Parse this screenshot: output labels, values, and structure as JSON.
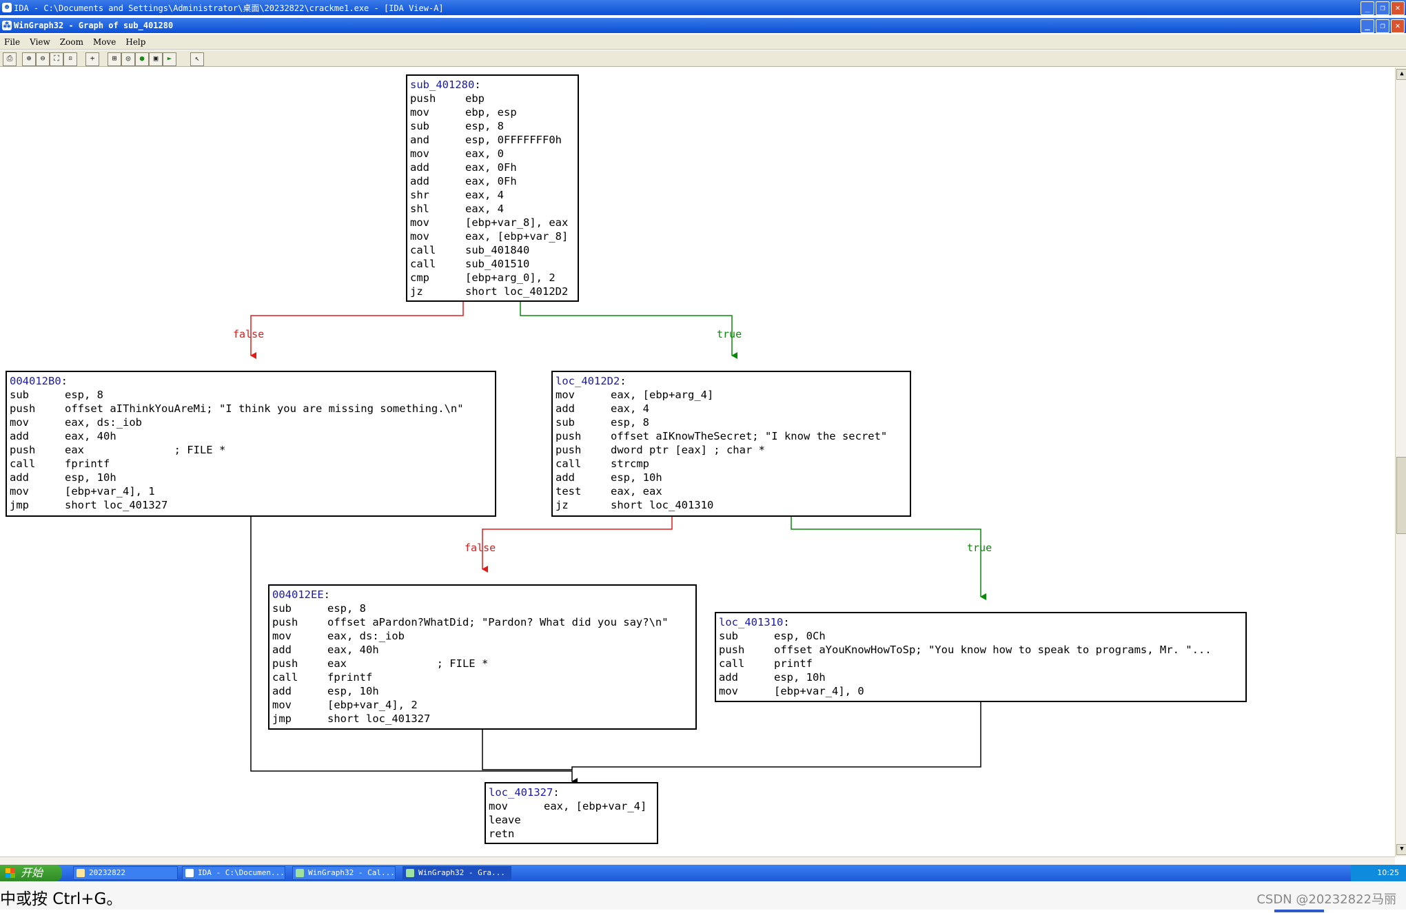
{
  "window": {
    "outer_title": "IDA - C:\\Documents and Settings\\Administrator\\桌面\\20232822\\crackme1.exe - [IDA View-A]",
    "inner_title": "WinGraph32 - Graph of sub_401280",
    "buttons": {
      "minimize": "_",
      "restore": "❐",
      "close": "✕"
    }
  },
  "menu": [
    "File",
    "View",
    "Zoom",
    "Move",
    "Help"
  ],
  "toolbar": {
    "icons": [
      "print-icon",
      "zoom-in-icon",
      "zoom-out-icon",
      "fit-icon",
      "zoom-100-icon",
      "center-icon",
      "layout-icon",
      "circle-icon",
      "green-circle-icon",
      "overview-icon",
      "green-arrow-icon",
      "cursor-icon"
    ]
  },
  "graph": {
    "nodes": {
      "sub_401280": {
        "label": "sub_401280",
        "rows": [
          [
            "push",
            "ebp"
          ],
          [
            "mov",
            "ebp, esp"
          ],
          [
            "sub",
            "esp, 8"
          ],
          [
            "and",
            "esp, 0FFFFFFF0h"
          ],
          [
            "mov",
            "eax, 0"
          ],
          [
            "add",
            "eax, 0Fh"
          ],
          [
            "add",
            "eax, 0Fh"
          ],
          [
            "shr",
            "eax, 4"
          ],
          [
            "shl",
            "eax, 4"
          ],
          [
            "mov",
            "[ebp+var_8], eax"
          ],
          [
            "mov",
            "eax, [ebp+var_8]"
          ],
          [
            "call",
            "sub_401840"
          ],
          [
            "call",
            "sub_401510"
          ],
          [
            "cmp",
            "[ebp+arg_0], 2"
          ],
          [
            "jz",
            "short loc_4012D2"
          ]
        ]
      },
      "n_4012B0": {
        "label": "004012B0",
        "rows": [
          [
            "sub",
            "esp, 8"
          ],
          [
            "push",
            "offset aIThinkYouAreMi; \"I think you are missing something.\\n\""
          ],
          [
            "mov",
            "eax, ds:_iob"
          ],
          [
            "add",
            "eax, 40h"
          ],
          [
            "push",
            "eax              ; FILE *"
          ],
          [
            "call",
            "fprintf"
          ],
          [
            "add",
            "esp, 10h"
          ],
          [
            "mov",
            "[ebp+var_4], 1"
          ],
          [
            "jmp",
            "short loc_401327"
          ]
        ]
      },
      "loc_4012D2": {
        "label": "loc_4012D2",
        "rows": [
          [
            "mov",
            "eax, [ebp+arg_4]"
          ],
          [
            "add",
            "eax, 4"
          ],
          [
            "sub",
            "esp, 8"
          ],
          [
            "push",
            "offset aIKnowTheSecret; \"I know the secret\""
          ],
          [
            "push",
            "dword ptr [eax] ; char *"
          ],
          [
            "call",
            "strcmp"
          ],
          [
            "add",
            "esp, 10h"
          ],
          [
            "test",
            "eax, eax"
          ],
          [
            "jz",
            "short loc_401310"
          ]
        ]
      },
      "n_4012EE": {
        "label": "004012EE",
        "rows": [
          [
            "sub",
            "esp, 8"
          ],
          [
            "push",
            "offset aPardon?WhatDid; \"Pardon? What did you say?\\n\""
          ],
          [
            "mov",
            "eax, ds:_iob"
          ],
          [
            "add",
            "eax, 40h"
          ],
          [
            "push",
            "eax              ; FILE *"
          ],
          [
            "call",
            "fprintf"
          ],
          [
            "add",
            "esp, 10h"
          ],
          [
            "mov",
            "[ebp+var_4], 2"
          ],
          [
            "jmp",
            "short loc_401327"
          ]
        ]
      },
      "loc_401310": {
        "label": "loc_401310",
        "rows": [
          [
            "sub",
            "esp, 0Ch"
          ],
          [
            "push",
            "offset aYouKnowHowToSp; \"You know how to speak to programs, Mr. \"..."
          ],
          [
            "call",
            "printf"
          ],
          [
            "add",
            "esp, 10h"
          ],
          [
            "mov",
            "[ebp+var_4], 0"
          ]
        ]
      },
      "loc_401327": {
        "label": "loc_401327",
        "rows": [
          [
            "mov",
            "eax, [ebp+var_4]"
          ],
          [
            "leave",
            ""
          ],
          [
            "retn",
            ""
          ]
        ]
      }
    },
    "edge_labels": {
      "false1": "false",
      "true1": "true",
      "false2": "false",
      "true2": "true"
    },
    "colors": {
      "false": "#e21b1b",
      "true": "#0a8a0a",
      "plain": "#000000",
      "label": "#1a1aa6"
    }
  },
  "taskbar": {
    "start": "开始",
    "tasks": [
      "20232822",
      "IDA - C:\\Documen...",
      "WinGraph32 - Cal...",
      "WinGraph32 - Gra..."
    ],
    "clock": "10:25"
  },
  "bottom": {
    "text": "中或按 Ctrl+G。",
    "watermark": "CSDN @20232822马丽"
  }
}
